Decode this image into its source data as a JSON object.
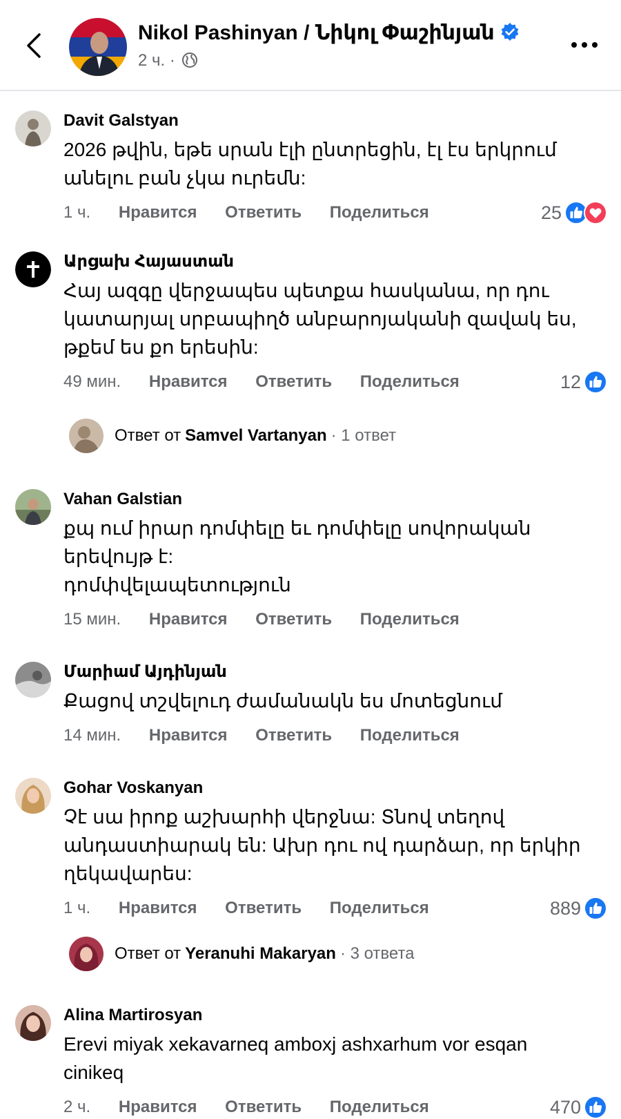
{
  "header": {
    "page_name": "Nikol Pashinyan / Նիկոլ Փաշինյան",
    "time": "2 ч.",
    "separator": "·",
    "back_icon": "chevron-left-icon",
    "verified_icon": "verified-badge-icon",
    "privacy_icon": "globe-icon",
    "more_icon": "more-horizontal-icon"
  },
  "action_labels": {
    "like": "Нравится",
    "reply": "Ответить",
    "share": "Поделиться"
  },
  "colors": {
    "like_blue": "#1877f2",
    "love_red": "#f33e58",
    "secondary_text": "#65676b",
    "divider": "#e4e6eb"
  },
  "comments": [
    {
      "author": "Davit Galstyan",
      "lines": [
        "2026 թվին, եթե սրան էլի ընտրեցին, էլ էս երկրում",
        "անելու բան չկա ուրեմն:"
      ],
      "time": "1 ч.",
      "reaction_count": "25",
      "reactions": [
        "like",
        "love"
      ]
    },
    {
      "author": "Արցախ Հայաստան",
      "lines": [
        "Հայ ազգը վերջապես պետքա հասկանա, որ դու",
        "կատարյալ սրբապիղծ անբարոյականի զավակ ես,",
        "թքեմ ես քո երեսին:"
      ],
      "time": "49 мин.",
      "reaction_count": "12",
      "reactions": [
        "like"
      ],
      "reply_summary": {
        "prefix": "Ответ от",
        "name": "Samvel Vartanyan",
        "count": "· 1 ответ"
      }
    },
    {
      "author": "Vahan Galstian",
      "lines": [
        "քպ ում իրար դոմփելը եւ դոմփելը սովորական",
        "երեվույթ է:",
        " դոմփվելապետություն"
      ],
      "time": "15 мин."
    },
    {
      "author": "Մարիամ Այդինյան",
      "lines": [
        "Քացով տշվելուդ ժամանակն ես մոտեցնում"
      ],
      "time": "14 мин."
    },
    {
      "author": "Gohar Voskanyan",
      "lines": [
        "Չէ սա իրոք աշխարհի վերջնա: Տնով տեղով",
        "անդաստիարակ են: Ախր դու ով դարձար, որ երկիր",
        "ղեկավարես:"
      ],
      "time": "1 ч.",
      "reaction_count": "889",
      "reactions": [
        "like"
      ],
      "reply_summary": {
        "prefix": "Ответ от",
        "name": "Yeranuhi Makaryan",
        "count": "· 3 ответа"
      }
    },
    {
      "author": "Alina Martirosyan",
      "lines": [
        "Erevi miyak xekavarneq amboxj ashxarhum vor esqan",
        "cinikeq"
      ],
      "time": "2 ч.",
      "reaction_count": "470",
      "reactions": [
        "like"
      ]
    }
  ]
}
